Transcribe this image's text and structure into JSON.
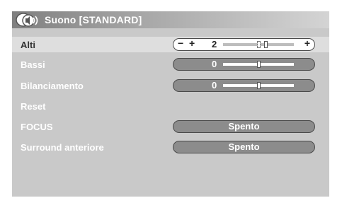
{
  "header": {
    "title": "Suono [STANDARD]",
    "icon": "sound-menu-icon"
  },
  "rows": [
    {
      "label": "Alti",
      "minus": "−",
      "plus1": "+",
      "value": "2",
      "plus2": "+",
      "level": 2,
      "range": [
        -10,
        10
      ]
    },
    {
      "label": "Bassi",
      "value": "0",
      "level": 0,
      "range": [
        -10,
        10
      ]
    },
    {
      "label": "Bilanciamento",
      "value": "0",
      "level": 0,
      "range": [
        -10,
        10
      ]
    },
    {
      "label": "Reset"
    },
    {
      "label": "FOCUS",
      "value": "Spento"
    },
    {
      "label": "Surround anteriore",
      "value": "Spento"
    }
  ],
  "colors": {
    "panel": "#c9c9c9",
    "highlight_row": "#dedede",
    "pill": "#8c8c8c",
    "pill_active": "#ffffff",
    "text": "#ffffff"
  }
}
